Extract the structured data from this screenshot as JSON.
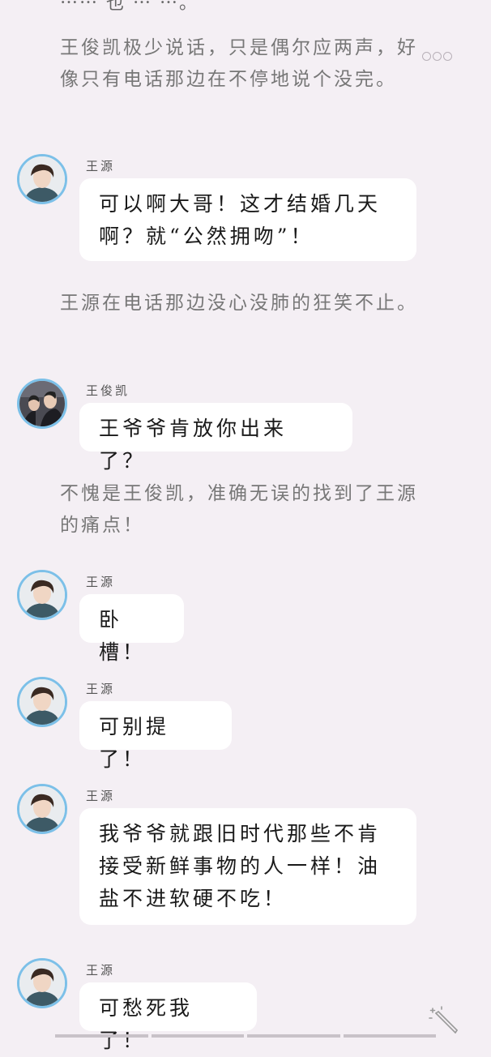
{
  "story": {
    "top_partial": "⋯⋯ 也 ⋯ ⋯。",
    "narr1": "王俊凯极少说话，只是偶尔应两声，好像只有电话那边在不停地说个没完。",
    "narr2": "王源在电话那边没心没肺的狂笑不止。",
    "narr3": "不愧是王俊凯，准确无误的找到了王源的痛点！",
    "messages": [
      {
        "speaker": "王源",
        "text": "可以啊大哥！这才结婚几天啊？就“公然拥吻”！"
      },
      {
        "speaker": "王俊凯",
        "text": "王爷爷肯放你出来了？"
      },
      {
        "speaker": "王源",
        "text": "卧槽！"
      },
      {
        "speaker": "王源",
        "text": "可别提了！"
      },
      {
        "speaker": "王源",
        "text": "我爷爷就跟旧时代那些不肯接受新鲜事物的人一样！油盐不进软硬不吃！"
      },
      {
        "speaker": "王源",
        "text": "可愁死我了！"
      }
    ]
  },
  "icons": {
    "more": "more-dots-icon",
    "magic": "magic-wand-icon"
  },
  "colors": {
    "background": "#f4eff4",
    "avatar_ring": "#7cc0e8",
    "bubble": "#ffffff",
    "narration_text": "#777777"
  }
}
